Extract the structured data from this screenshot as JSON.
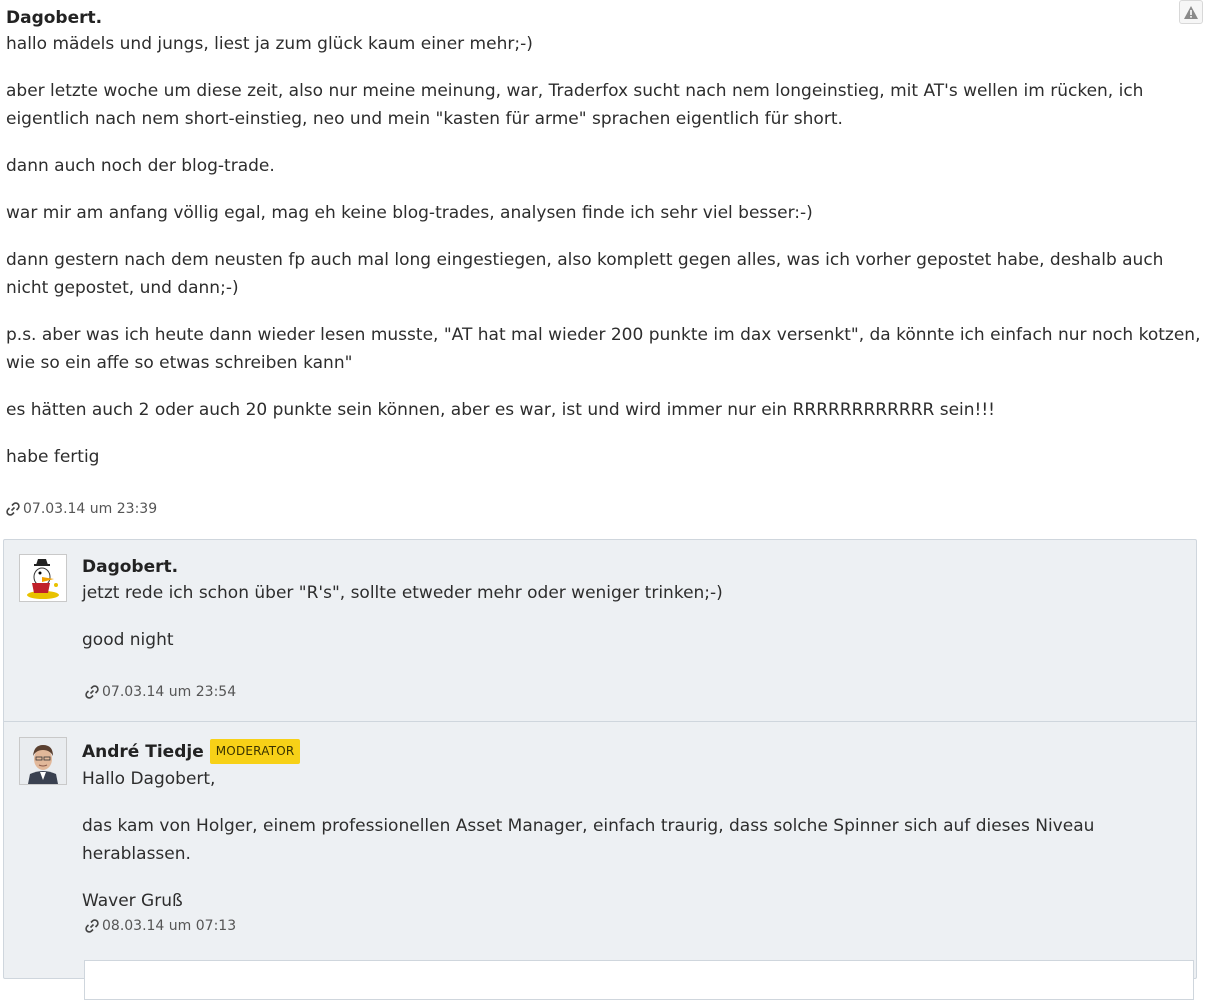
{
  "main_post": {
    "author": "Dagobert.",
    "paragraphs": [
      "hallo mädels und jungs, liest ja zum glück kaum einer mehr;-)",
      "aber letzte woche um diese zeit, also nur meine meinung, war, Traderfox sucht nach nem longeinstieg, mit AT's wellen im rücken, ich eigentlich nach nem short-einstieg, neo und mein \"kasten für arme\" sprachen eigentlich für short.",
      "dann auch noch der blog-trade.",
      "war mir am anfang völlig egal, mag eh keine blog-trades, analysen finde ich sehr viel besser:-)",
      "dann gestern nach dem neusten fp auch mal long eingestiegen, also komplett gegen alles, was ich vorher gepostet habe, deshalb auch nicht gepostet, und dann;-)",
      "p.s. aber was ich heute dann wieder lesen musste, \"AT hat mal wieder 200 punkte im dax versenkt\", da könnte ich einfach nur noch kotzen, wie so ein affe so etwas schreiben kann\"",
      "es hätten auch 2 oder auch 20 punkte sein können, aber es war, ist und wird immer nur ein RRRRRRRRRRRR sein!!!",
      "habe fertig"
    ],
    "timestamp": "07.03.14 um 23:39"
  },
  "replies": [
    {
      "author": "Dagobert.",
      "badge": "",
      "paragraphs": [
        "jetzt rede ich schon über \"R's\", sollte etweder mehr oder weniger trinken;-)",
        "good night"
      ],
      "timestamp": "07.03.14 um 23:54"
    },
    {
      "author": "André Tiedje",
      "badge": "MODERATOR",
      "paragraphs": [
        "Hallo Dagobert,",
        "das kam von Holger, einem professionellen Asset Manager, einfach traurig, dass solche Spinner sich auf dieses Niveau herablassen.",
        "Waver Gruß"
      ],
      "timestamp": "08.03.14 um 07:13"
    }
  ],
  "icons": {
    "report": "warning-icon",
    "permalink": "link-icon"
  },
  "colors": {
    "reply_background": "#edf0f3",
    "badge": "#f7d117"
  }
}
